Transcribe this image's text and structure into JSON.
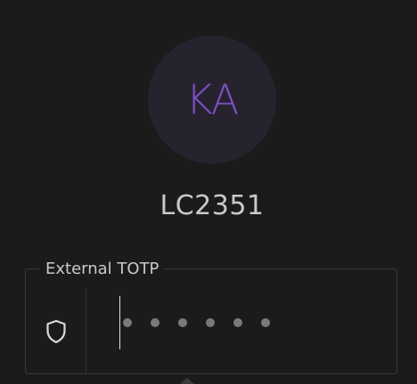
{
  "avatar": {
    "initials": "KA"
  },
  "user": {
    "username": "LC2351"
  },
  "totp": {
    "label": "External TOTP",
    "icon": "shield-icon",
    "code_length": 6,
    "entered_digits": 0
  },
  "colors": {
    "background": "#1b1b1b",
    "avatar_bg": "#26232f",
    "avatar_text": "#7e4fc4",
    "border": "#3a3a3a"
  }
}
